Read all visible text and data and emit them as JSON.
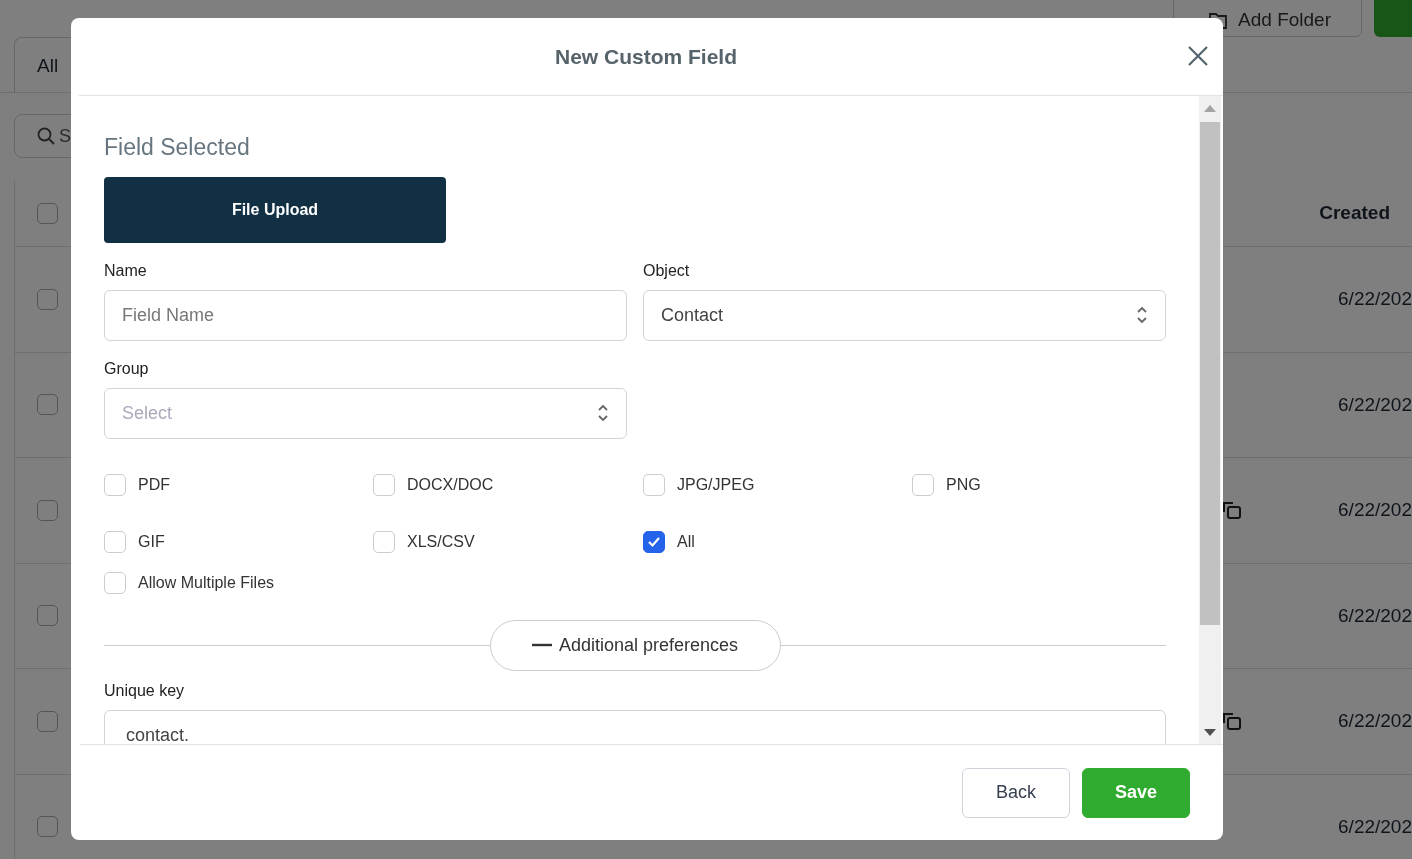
{
  "background": {
    "tab": "All",
    "add_folder_button": "Add Folder",
    "search_placeholder": "S",
    "column_header": "Created",
    "header_checked": false,
    "rows": [
      {
        "date": "6/22/202",
        "copy_icon": false,
        "checked": false
      },
      {
        "date": "6/22/202",
        "copy_icon": false,
        "checked": false
      },
      {
        "date": "6/22/202",
        "copy_icon": true,
        "checked": false
      },
      {
        "date": "6/22/202",
        "copy_icon": false,
        "checked": false
      },
      {
        "date": "6/22/202",
        "copy_icon": true,
        "checked": false
      },
      {
        "date": "6/22/202",
        "copy_icon": false,
        "checked": false
      }
    ]
  },
  "modal": {
    "title": "New Custom Field",
    "field_selected_label": "Field Selected",
    "field_type_button": "File Upload",
    "name": {
      "label": "Name",
      "placeholder": "Field Name"
    },
    "object": {
      "label": "Object",
      "value": "Contact"
    },
    "group": {
      "label": "Group",
      "placeholder": "Select"
    },
    "file_types": [
      {
        "label": "PDF",
        "checked": false
      },
      {
        "label": "DOCX/DOC",
        "checked": false
      },
      {
        "label": "JPG/JPEG",
        "checked": false
      },
      {
        "label": "PNG",
        "checked": false
      },
      {
        "label": "GIF",
        "checked": false
      },
      {
        "label": "XLS/CSV",
        "checked": false
      },
      {
        "label": "All",
        "checked": true
      }
    ],
    "allow_multiple": {
      "label": "Allow Multiple Files",
      "checked": false
    },
    "additional_preferences": {
      "label": "Additional preferences",
      "expanded": true
    },
    "unique_key": {
      "label": "Unique key",
      "value": "contact."
    },
    "buttons": [
      {
        "label": "Back",
        "kind": "secondary"
      },
      {
        "label": "Save",
        "kind": "primary"
      }
    ]
  }
}
